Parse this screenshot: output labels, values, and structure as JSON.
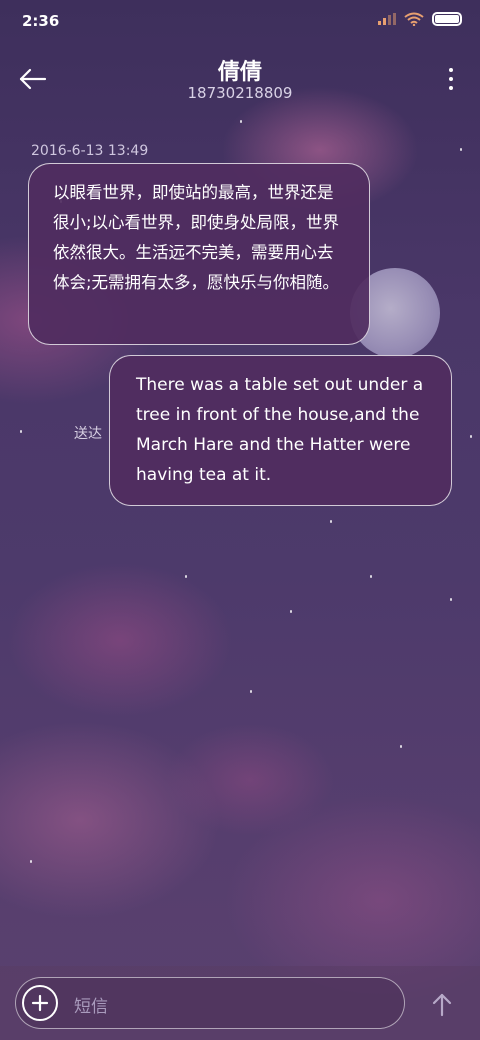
{
  "status_bar": {
    "time": "2:36"
  },
  "header": {
    "title": "倩倩",
    "subtitle": "18730218809"
  },
  "conversation": {
    "timestamp": "2016-6-13 13:49",
    "messages": [
      {
        "direction": "incoming",
        "text": "以眼看世界，即使站的最高，世界还是很小;以心看世界，即使身处局限，世界依然很大。生活远不完美，需要用心去体会;无需拥有太多，愿快乐与你相随。"
      },
      {
        "direction": "outgoing",
        "text": "There was a table set out under a tree in front of the house,and the March Hare and the Hatter were having tea at it.",
        "status": "送达"
      }
    ]
  },
  "composer": {
    "placeholder": "短信"
  },
  "icons": {
    "back": "arrow-left-icon",
    "more": "more-vertical-icon",
    "add": "plus-icon",
    "send": "arrow-up-icon",
    "wifi": "wifi-icon",
    "battery": "battery-icon",
    "signal": "signal-icon"
  },
  "colors": {
    "bubble": "#502d5f",
    "accent": "#e8a070"
  }
}
